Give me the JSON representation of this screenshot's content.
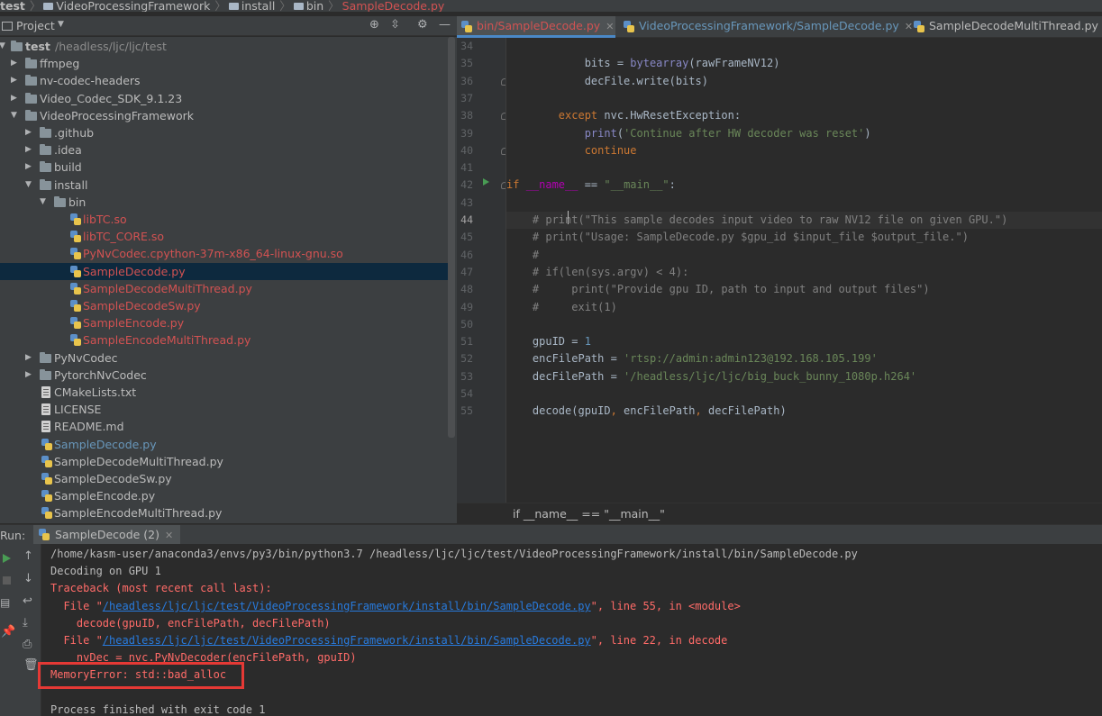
{
  "breadcrumb": {
    "items": [
      "test",
      "VideoProcessingFramework",
      "install",
      "bin",
      "SampleDecode.py"
    ]
  },
  "project_panel": {
    "title": "Project",
    "root": {
      "name": "test",
      "path": "/headless/ljc/ljc/test"
    },
    "tree": [
      {
        "label": "ffmpeg",
        "type": "folder",
        "depth": 1,
        "expanded": false,
        "color": "default"
      },
      {
        "label": "nv-codec-headers",
        "type": "folder",
        "depth": 1,
        "expanded": false,
        "color": "default"
      },
      {
        "label": "Video_Codec_SDK_9.1.23",
        "type": "folder",
        "depth": 1,
        "expanded": false,
        "color": "default"
      },
      {
        "label": "VideoProcessingFramework",
        "type": "folder",
        "depth": 1,
        "expanded": true,
        "color": "default"
      },
      {
        "label": ".github",
        "type": "folder",
        "depth": 2,
        "expanded": false,
        "color": "default"
      },
      {
        "label": ".idea",
        "type": "folder",
        "depth": 2,
        "expanded": false,
        "color": "default"
      },
      {
        "label": "build",
        "type": "folder",
        "depth": 2,
        "expanded": false,
        "color": "default"
      },
      {
        "label": "install",
        "type": "folder",
        "depth": 2,
        "expanded": true,
        "color": "default"
      },
      {
        "label": "bin",
        "type": "folder",
        "depth": 3,
        "expanded": true,
        "color": "default"
      },
      {
        "label": "libTC.so",
        "type": "lib",
        "depth": 4,
        "color": "red"
      },
      {
        "label": "libTC_CORE.so",
        "type": "lib",
        "depth": 4,
        "color": "red"
      },
      {
        "label": "PyNvCodec.cpython-37m-x86_64-linux-gnu.so",
        "type": "lib",
        "depth": 4,
        "color": "red"
      },
      {
        "label": "SampleDecode.py",
        "type": "py",
        "depth": 4,
        "color": "red",
        "selected": true
      },
      {
        "label": "SampleDecodeMultiThread.py",
        "type": "py",
        "depth": 4,
        "color": "red"
      },
      {
        "label": "SampleDecodeSw.py",
        "type": "py",
        "depth": 4,
        "color": "red"
      },
      {
        "label": "SampleEncode.py",
        "type": "py",
        "depth": 4,
        "color": "red"
      },
      {
        "label": "SampleEncodeMultiThread.py",
        "type": "py",
        "depth": 4,
        "color": "red"
      },
      {
        "label": "PyNvCodec",
        "type": "folder",
        "depth": 2,
        "expanded": false,
        "color": "default"
      },
      {
        "label": "PytorchNvCodec",
        "type": "folder",
        "depth": 2,
        "expanded": false,
        "color": "default"
      },
      {
        "label": "CMakeLists.txt",
        "type": "txt",
        "depth": 2,
        "color": "default"
      },
      {
        "label": "LICENSE",
        "type": "txt",
        "depth": 2,
        "color": "default"
      },
      {
        "label": "README.md",
        "type": "txt",
        "depth": 2,
        "color": "default"
      },
      {
        "label": "SampleDecode.py",
        "type": "py",
        "depth": 2,
        "color": "blue"
      },
      {
        "label": "SampleDecodeMultiThread.py",
        "type": "py",
        "depth": 2,
        "color": "default"
      },
      {
        "label": "SampleDecodeSw.py",
        "type": "py",
        "depth": 2,
        "color": "default"
      },
      {
        "label": "SampleEncode.py",
        "type": "py",
        "depth": 2,
        "color": "default"
      },
      {
        "label": "SampleEncodeMultiThread.py",
        "type": "py",
        "depth": 2,
        "color": "default"
      }
    ]
  },
  "editor": {
    "tabs": [
      {
        "label": "bin/SampleDecode.py",
        "active": true,
        "color": "red"
      },
      {
        "label": "VideoProcessingFramework/SampleDecode.py",
        "active": false,
        "color": "blue"
      },
      {
        "label": "SampleDecodeMultiThread.py",
        "active": false,
        "color": "default"
      }
    ],
    "current_line": "44",
    "run_marker_line": "42",
    "lines": [
      {
        "n": "34",
        "code": []
      },
      {
        "n": "35",
        "code": [
          [
            "",
            "            bits = "
          ],
          [
            "fn",
            "bytearray"
          ],
          [
            "",
            "(rawFrameNV12)"
          ]
        ]
      },
      {
        "n": "36",
        "code": [
          [
            "",
            "            decFile.write(bits)"
          ]
        ]
      },
      {
        "n": "37",
        "code": []
      },
      {
        "n": "38",
        "code": [
          [
            "kw",
            "        except "
          ],
          [
            "",
            "nvc.HwResetException:"
          ]
        ]
      },
      {
        "n": "39",
        "code": [
          [
            "fn",
            "            print"
          ],
          [
            "",
            "("
          ],
          [
            "str",
            "'Continue after HW decoder was reset'"
          ],
          [
            "",
            ")"
          ]
        ]
      },
      {
        "n": "40",
        "code": [
          [
            "kw",
            "            continue"
          ]
        ]
      },
      {
        "n": "41",
        "code": []
      },
      {
        "n": "42",
        "code": [
          [
            "kw",
            "if "
          ],
          [
            "dunder",
            "__name__"
          ],
          [
            "",
            " == "
          ],
          [
            "str",
            "\"__main__\""
          ],
          [
            "",
            ":"
          ]
        ]
      },
      {
        "n": "43",
        "code": []
      },
      {
        "n": "44",
        "code": [
          [
            "com",
            "    # print(\"This sample decodes input video to raw NV12 file on given GPU.\")"
          ]
        ]
      },
      {
        "n": "45",
        "code": [
          [
            "com",
            "    # print(\"Usage: SampleDecode.py $gpu_id $input_file $output_file.\")"
          ]
        ]
      },
      {
        "n": "46",
        "code": [
          [
            "com",
            "    #"
          ]
        ]
      },
      {
        "n": "47",
        "code": [
          [
            "com",
            "    # if(len(sys.argv) < 4):"
          ]
        ]
      },
      {
        "n": "48",
        "code": [
          [
            "com",
            "    #     print(\"Provide gpu ID, path to input and output files\")"
          ]
        ]
      },
      {
        "n": "49",
        "code": [
          [
            "com",
            "    #     exit(1)"
          ]
        ]
      },
      {
        "n": "50",
        "code": []
      },
      {
        "n": "51",
        "code": [
          [
            "",
            "    gpuID = "
          ],
          [
            "num",
            "1"
          ]
        ]
      },
      {
        "n": "52",
        "code": [
          [
            "",
            "    encFilePath = "
          ],
          [
            "str",
            "'rtsp://admin:admin123@192.168.105.199'"
          ]
        ]
      },
      {
        "n": "53",
        "code": [
          [
            "",
            "    decFilePath = "
          ],
          [
            "str",
            "'/headless/ljc/ljc/big_buck_bunny_1080p.h264'"
          ]
        ]
      },
      {
        "n": "54",
        "code": []
      },
      {
        "n": "55",
        "code": [
          [
            "",
            "    decode(gpuID"
          ],
          [
            "kw",
            ", "
          ],
          [
            "",
            "encFilePath"
          ],
          [
            "kw",
            ", "
          ],
          [
            "",
            "decFilePath)"
          ]
        ]
      }
    ],
    "breadcrumb": "if __name__ == \"__main__\""
  },
  "run_panel": {
    "label": "Run:",
    "tab": "SampleDecode (2)",
    "output": [
      {
        "type": "normal",
        "parts": [
          [
            "",
            "/home/kasm-user/anaconda3/envs/py3/bin/python3.7 /headless/ljc/ljc/test/VideoProcessingFramework/install/bin/SampleDecode.py"
          ]
        ]
      },
      {
        "type": "normal",
        "parts": [
          [
            "",
            "Decoding on GPU 1"
          ]
        ]
      },
      {
        "type": "err",
        "parts": [
          [
            "err",
            "Traceback (most recent call last):"
          ]
        ]
      },
      {
        "type": "err",
        "parts": [
          [
            "err",
            "  File \""
          ],
          [
            "link",
            "/headless/ljc/ljc/test/VideoProcessingFramework/install/bin/SampleDecode.py"
          ],
          [
            "err",
            "\", line 55, in <module>"
          ]
        ]
      },
      {
        "type": "err",
        "parts": [
          [
            "err",
            "    decode(gpuID, encFilePath, decFilePath)"
          ]
        ]
      },
      {
        "type": "err",
        "parts": [
          [
            "err",
            "  File \""
          ],
          [
            "link",
            "/headless/ljc/ljc/test/VideoProcessingFramework/install/bin/SampleDecode.py"
          ],
          [
            "err",
            "\", line 22, in decode"
          ]
        ]
      },
      {
        "type": "err",
        "parts": [
          [
            "err",
            "    nvDec = nvc.PyNvDecoder(encFilePath, gpuID)"
          ]
        ]
      },
      {
        "type": "err",
        "parts": [
          [
            "err",
            "MemoryError: std::bad_alloc"
          ]
        ]
      },
      {
        "type": "normal",
        "parts": []
      },
      {
        "type": "normal",
        "parts": [
          [
            "",
            "Process finished with exit code 1"
          ]
        ]
      }
    ]
  },
  "colors": {
    "selection": "#0d293e",
    "error_box": "#e53935",
    "error_text": "#ff6b68",
    "link": "#287bde"
  },
  "icons": [
    "folder-icon",
    "python-file-icon",
    "settings-icon",
    "run-icon",
    "stop-icon",
    "scroll-up-icon",
    "scroll-down-icon",
    "print-icon",
    "trash-icon",
    "pin-icon"
  ]
}
